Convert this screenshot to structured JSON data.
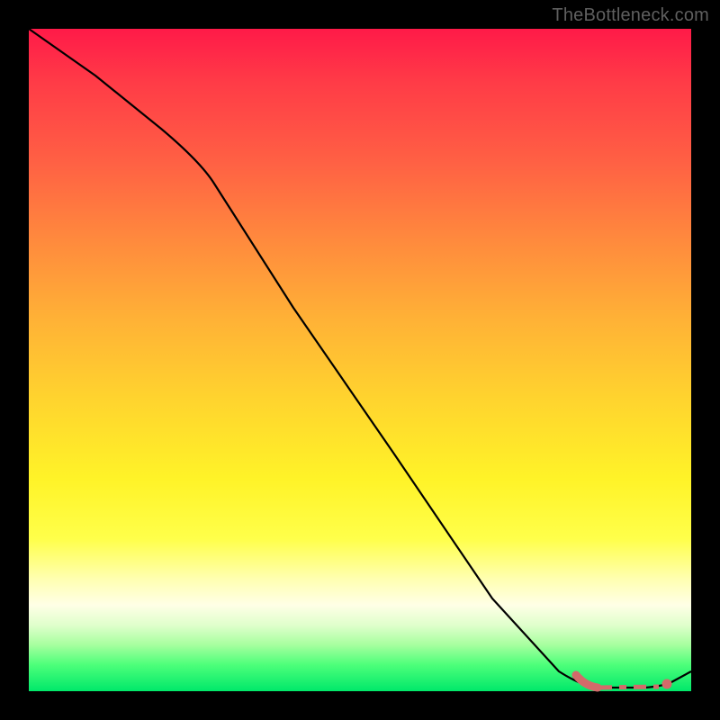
{
  "watermark": "TheBottleneck.com",
  "chart_data": {
    "type": "line",
    "title": "",
    "xlabel": "",
    "ylabel": "",
    "xlim": [
      0,
      100
    ],
    "ylim": [
      0,
      100
    ],
    "series": [
      {
        "name": "bottleneck-curve",
        "x": [
          0,
          10,
          20,
          26,
          40,
          55,
          70,
          80,
          83,
          88,
          93,
          96,
          100
        ],
        "y": [
          100,
          93,
          85,
          80,
          58,
          36,
          14,
          3,
          1,
          0.5,
          0.5,
          0.8,
          3
        ]
      }
    ],
    "highlight": {
      "name": "optimal-range",
      "x_start": 83,
      "x_end": 96,
      "y": 0.7
    },
    "background_gradient": {
      "top": "#ff1a48",
      "mid": "#ffe62e",
      "bottom": "#00e86a"
    }
  }
}
